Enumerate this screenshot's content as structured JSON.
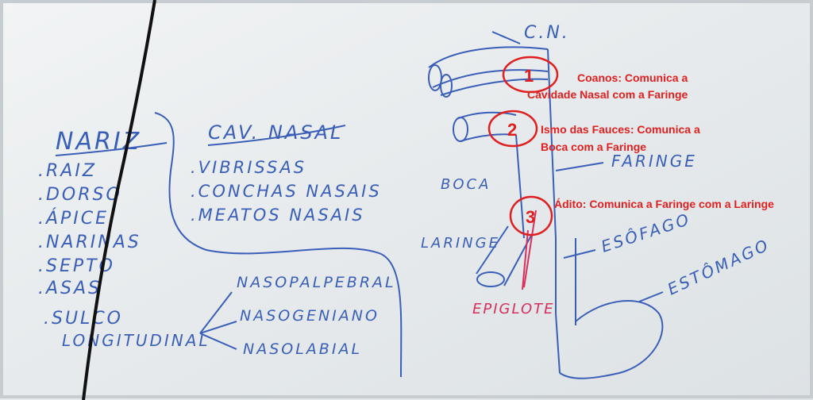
{
  "left_lists": {
    "nariz": {
      "title": "NARIZ",
      "items": [
        ".RAIZ",
        ".DORSO",
        ".ÁPICE",
        ".NARINAS",
        ".SEPTO",
        ".ASAS",
        ".SULCO",
        "LONGITUDINAL"
      ]
    },
    "cav_nasal": {
      "title": "CAV. NASAL",
      "items": [
        ".VIBRISSAS",
        ".CONCHAS NASAIS",
        ".MEATOS NASAIS"
      ]
    },
    "sulco_types": [
      "NASOPALPEBRAL",
      "NASOGENIANO",
      "NASOLABIAL"
    ]
  },
  "diagram_labels": {
    "cn": "C.N.",
    "boca": "BOCA",
    "faringe": "FARINGE",
    "laringe": "LARINGE",
    "esofago": "ESÔFAGO",
    "estomago": "ESTÔMAGO",
    "epiglote": "EPIGLOTE"
  },
  "annotations": [
    {
      "number": "1",
      "line1": "Coanos: Comunica a",
      "line2": "Cavidade Nasal com a Faringe"
    },
    {
      "number": "2",
      "line1": "Ismo das Fauces: Comunica a",
      "line2": "Boca com a Faringe"
    },
    {
      "number": "3",
      "line1": "Ádito: Comunica a Faringe com a Laringe",
      "line2": ""
    }
  ],
  "colors": {
    "board": "#e8ecee",
    "marker_blue": "#3a5fb8",
    "annotation_red": "#e02020",
    "marker_pink": "#d8305c",
    "cable": "#111111"
  }
}
